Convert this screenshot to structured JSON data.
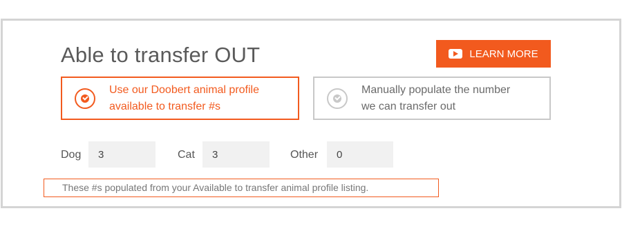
{
  "section": {
    "title": "Able to transfer OUT",
    "learn_more_label": "LEARN MORE"
  },
  "options": [
    {
      "line1": "Use our Doobert animal profile",
      "line2": "available to transfer #s",
      "selected": true
    },
    {
      "line1": "Manually populate the number",
      "line2": "we can transfer out",
      "selected": false
    }
  ],
  "counts": {
    "dog_label": "Dog",
    "dog_value": "3",
    "cat_label": "Cat",
    "cat_value": "3",
    "other_label": "Other",
    "other_value": "0"
  },
  "note": "These #s populated from your Available to transfer animal profile listing.",
  "colors": {
    "accent": "#f25a1e",
    "border": "#d4d4d4",
    "input_bg": "#f1f1f1"
  }
}
